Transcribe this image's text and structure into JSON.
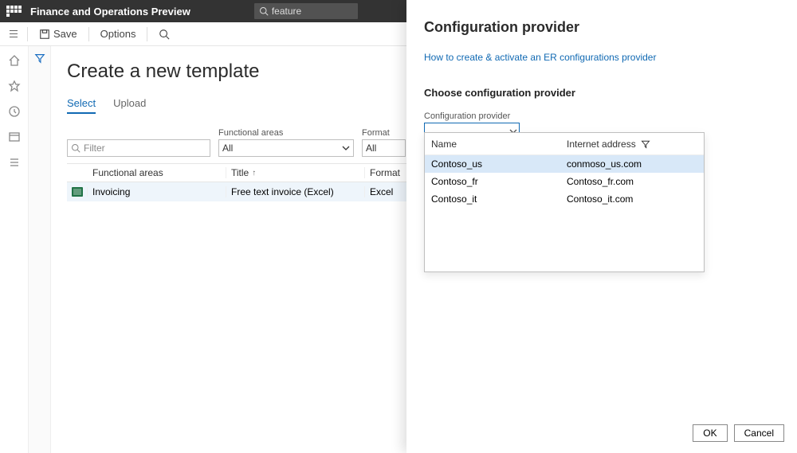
{
  "header": {
    "app_title": "Finance and Operations Preview",
    "search_text": "feature"
  },
  "actionbar": {
    "save_label": "Save",
    "options_label": "Options"
  },
  "page": {
    "title": "Create a new template",
    "tabs": {
      "select": "Select",
      "upload": "Upload"
    }
  },
  "filters": {
    "filter_placeholder": "Filter",
    "areas_label": "Functional areas",
    "areas_value": "All",
    "format_label": "Format",
    "format_value": "All"
  },
  "grid": {
    "col_areas": "Functional areas",
    "col_title": "Title",
    "col_format": "Format",
    "rows": [
      {
        "areas": "Invoicing",
        "title": "Free text invoice (Excel)",
        "format": "Excel"
      }
    ]
  },
  "flyout": {
    "heading": "Configuration provider",
    "help_link": "How to create & activate an ER configurations provider",
    "choose_label": "Choose configuration provider",
    "combo_label": "Configuration provider",
    "ok_label": "OK",
    "cancel_label": "Cancel"
  },
  "dropdown": {
    "col_name": "Name",
    "col_addr": "Internet address",
    "rows": [
      {
        "name": "Contoso_us",
        "addr": "conmoso_us.com",
        "selected": true
      },
      {
        "name": "Contoso_fr",
        "addr": "Contoso_fr.com",
        "selected": false
      },
      {
        "name": "Contoso_it",
        "addr": "Contoso_it.com",
        "selected": false
      }
    ]
  }
}
